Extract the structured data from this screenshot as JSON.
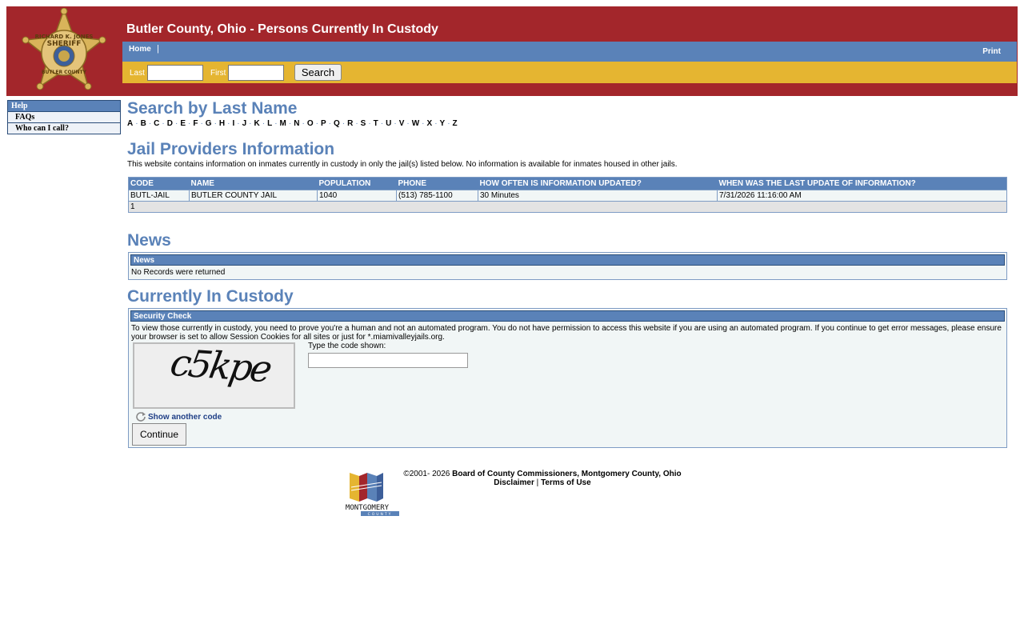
{
  "header": {
    "title": "Butler County, Ohio - Persons Currently In Custody",
    "nav_home": "Home",
    "nav_sep": "|",
    "print": "Print",
    "search": {
      "last_label": "Last",
      "first_label": "First",
      "last_value": "",
      "first_value": "",
      "button": "Search"
    },
    "badge_text": {
      "top": "RICHARD K. JONES",
      "center": "SHERIFF",
      "bottom": "BUTLER COUNTY"
    }
  },
  "sidebar": {
    "heading": "Help",
    "items": [
      {
        "label": "FAQs"
      },
      {
        "label": "Who can I call?"
      }
    ]
  },
  "search_by_last_name": {
    "title": "Search by Last Name",
    "letters": [
      "A",
      "B",
      "C",
      "D",
      "E",
      "F",
      "G",
      "H",
      "I",
      "J",
      "K",
      "L",
      "M",
      "N",
      "O",
      "P",
      "Q",
      "R",
      "S",
      "T",
      "U",
      "V",
      "W",
      "X",
      "Y",
      "Z"
    ],
    "separator": "·"
  },
  "providers": {
    "title": "Jail Providers Information",
    "description": "This website contains information on inmates currently in custody in only the jail(s) listed below. No information is available for inmates housed in other jails.",
    "columns": [
      "CODE",
      "NAME",
      "POPULATION",
      "PHONE",
      "HOW OFTEN IS INFORMATION UPDATED?",
      "WHEN WAS THE LAST UPDATE OF INFORMATION?"
    ],
    "rows": [
      [
        "BUTL-JAIL",
        "BUTLER COUNTY JAIL",
        "1040",
        "(513) 785-1100",
        "30 Minutes",
        "7/31/2026 11:16:00 AM"
      ]
    ],
    "footer": "1"
  },
  "news": {
    "title": "News",
    "panel_heading": "News",
    "empty_text": "No Records were returned"
  },
  "custody": {
    "title": "Currently In Custody",
    "panel_heading": "Security Check",
    "message": "To view those currently in custody, you need to prove you're a human and not an automated program. You do not have permission to access this website if you are using an automated program. If you continue to get error messages, please ensure your browser is set to allow Session Cookies for all sites or just for *.miamivalleyjails.org.",
    "captcha_code": "c5kpe",
    "code_label": "Type the code shown:",
    "code_value": "",
    "show_another": "Show another code",
    "continue": "Continue"
  },
  "footer": {
    "copyright": "©2001- 2026",
    "owner": "Board of County Commissioners, Montgomery County, Ohio",
    "disclaimer": "Disclaimer",
    "sep": "|",
    "terms": "Terms of Use",
    "logo_text": "MONTGOMERY",
    "logo_subtext": "COUNTY"
  },
  "colors": {
    "header_red": "#a3262b",
    "nav_blue": "#5a82b8",
    "search_gold": "#e5b531",
    "panel_bg": "#f1f6f6"
  }
}
